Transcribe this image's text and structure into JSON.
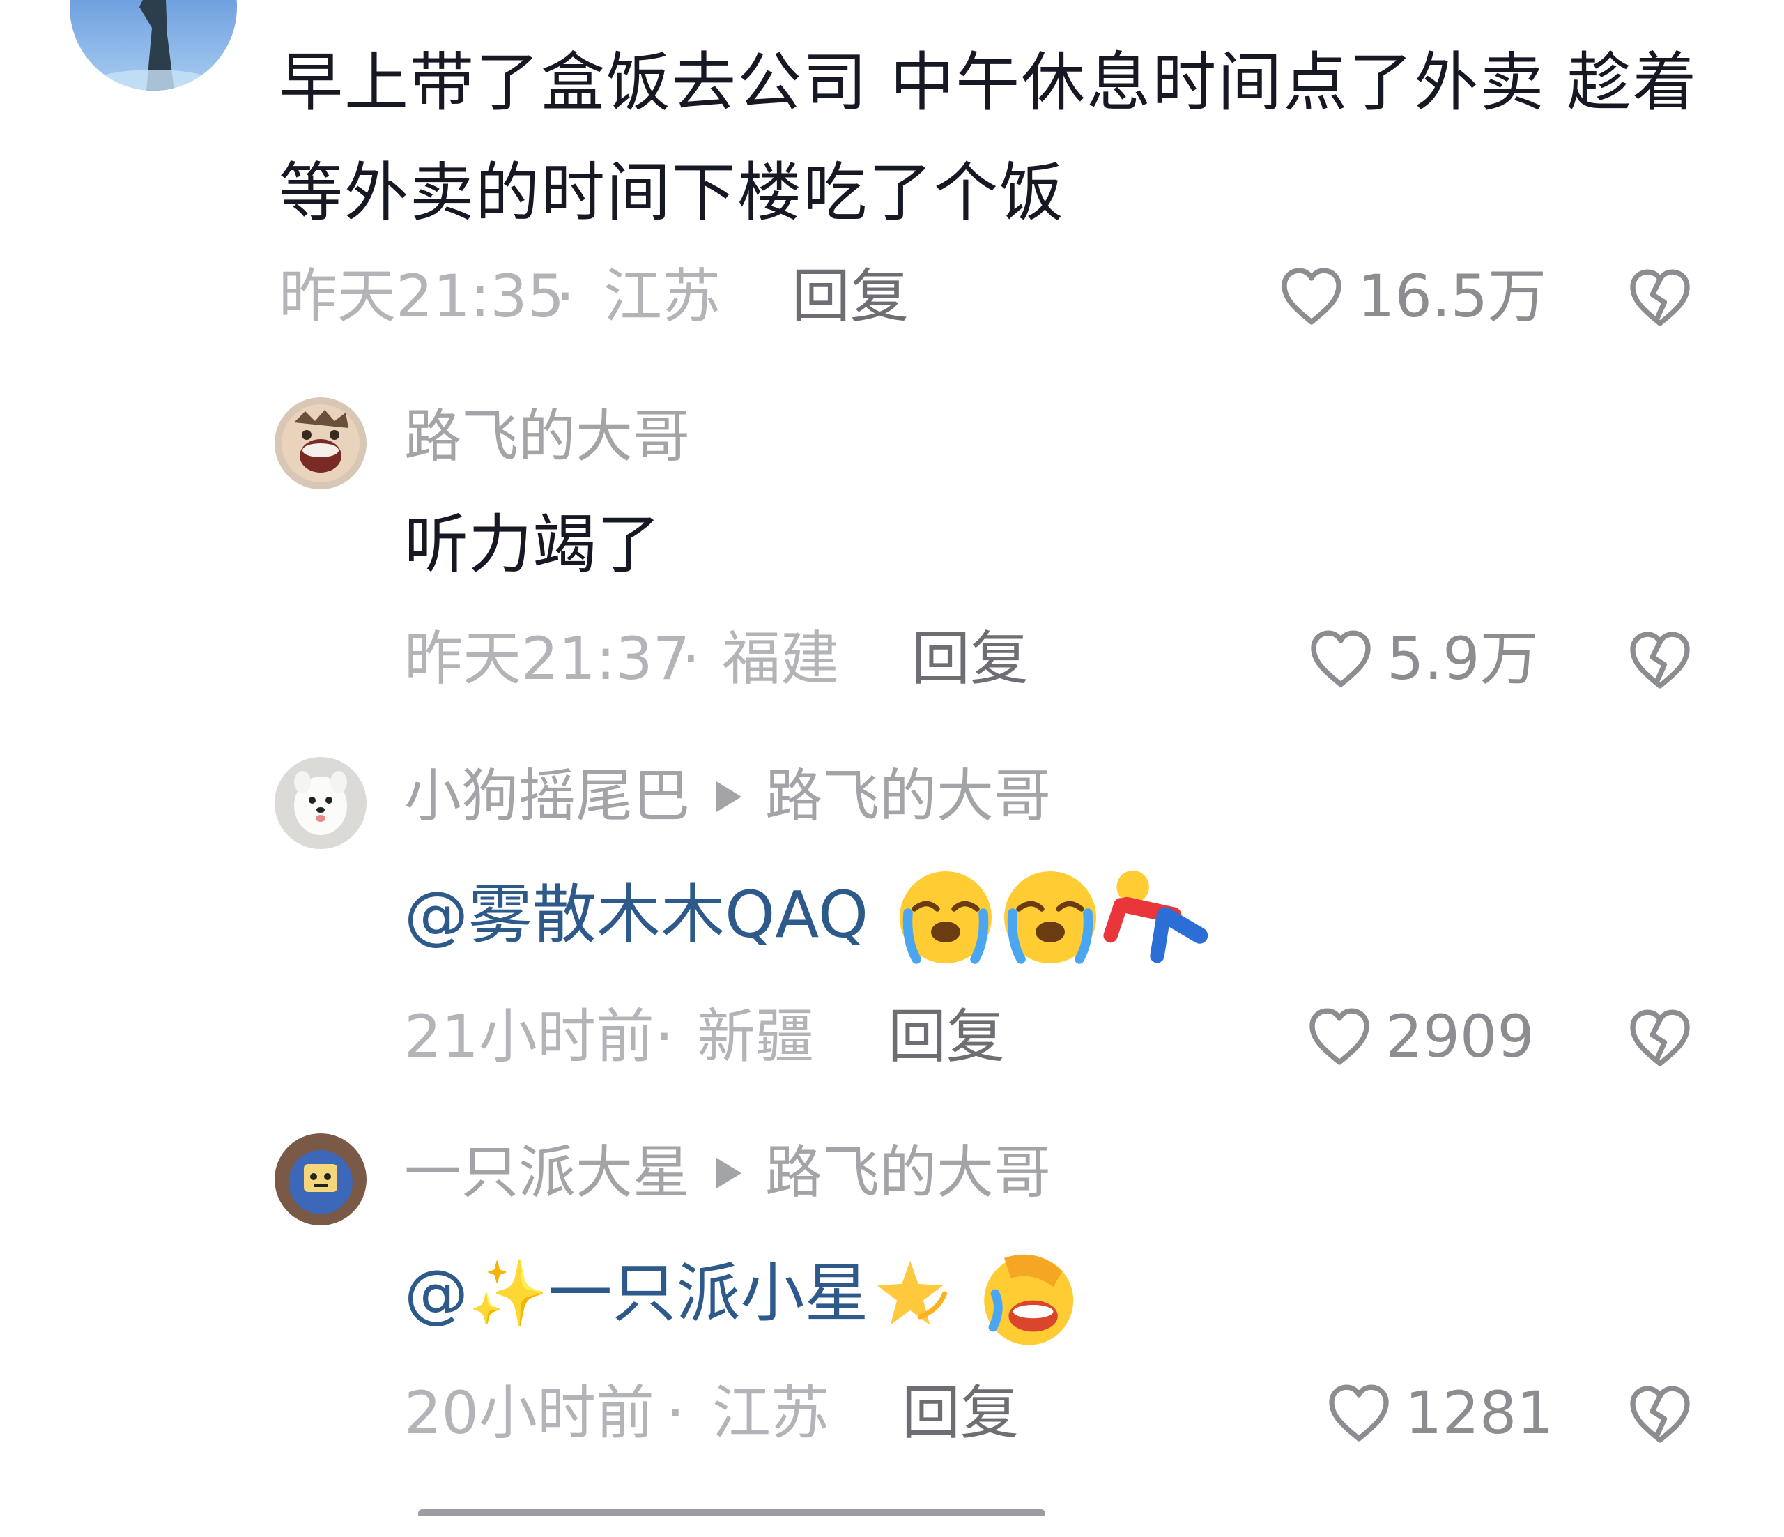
{
  "main_comment": {
    "avatar_icon": "statue-avatar",
    "text": "早上带了盒饭去公司 中午休息时间点了外卖 趁着等外卖的时间下楼吃了个饭",
    "time": "昨天21:35",
    "separator": "·",
    "location": "江苏",
    "reply_label": "回复",
    "likes": "16.5万"
  },
  "replies": [
    {
      "avatar_icon": "anime-laughing-avatar",
      "name": "路飞的大哥",
      "target": "",
      "text": "听力竭了",
      "mention": "",
      "emojis": [],
      "time": "昨天21:37",
      "separator": "·",
      "location": "福建",
      "reply_label": "回复",
      "likes": "5.9万"
    },
    {
      "avatar_icon": "white-dog-avatar",
      "name": "小狗摇尾巴",
      "target": "路飞的大哥",
      "mention": "@雾散木木QAQ",
      "emojis": [
        "crying-face-icon",
        "crying-face-icon",
        "falling-person-icon"
      ],
      "time": "21小时前",
      "separator": "·",
      "location": "新疆",
      "reply_label": "回复",
      "likes": "2909"
    },
    {
      "avatar_icon": "blue-toy-avatar",
      "name": "一只派大星",
      "target": "路飞的大哥",
      "mention": "@✨一只派小星",
      "emojis": [
        "dizzy-star-icon",
        "facepalm-laugh-icon"
      ],
      "time": "20小时前",
      "separator": "·",
      "location": "江苏",
      "reply_label": "回复",
      "likes": "1281"
    }
  ],
  "colors": {
    "text": "#161823",
    "meta": "#b3b4b8",
    "reply": "#6d6e73",
    "mention": "#2d5a8a",
    "icon": "#8c8d91"
  }
}
